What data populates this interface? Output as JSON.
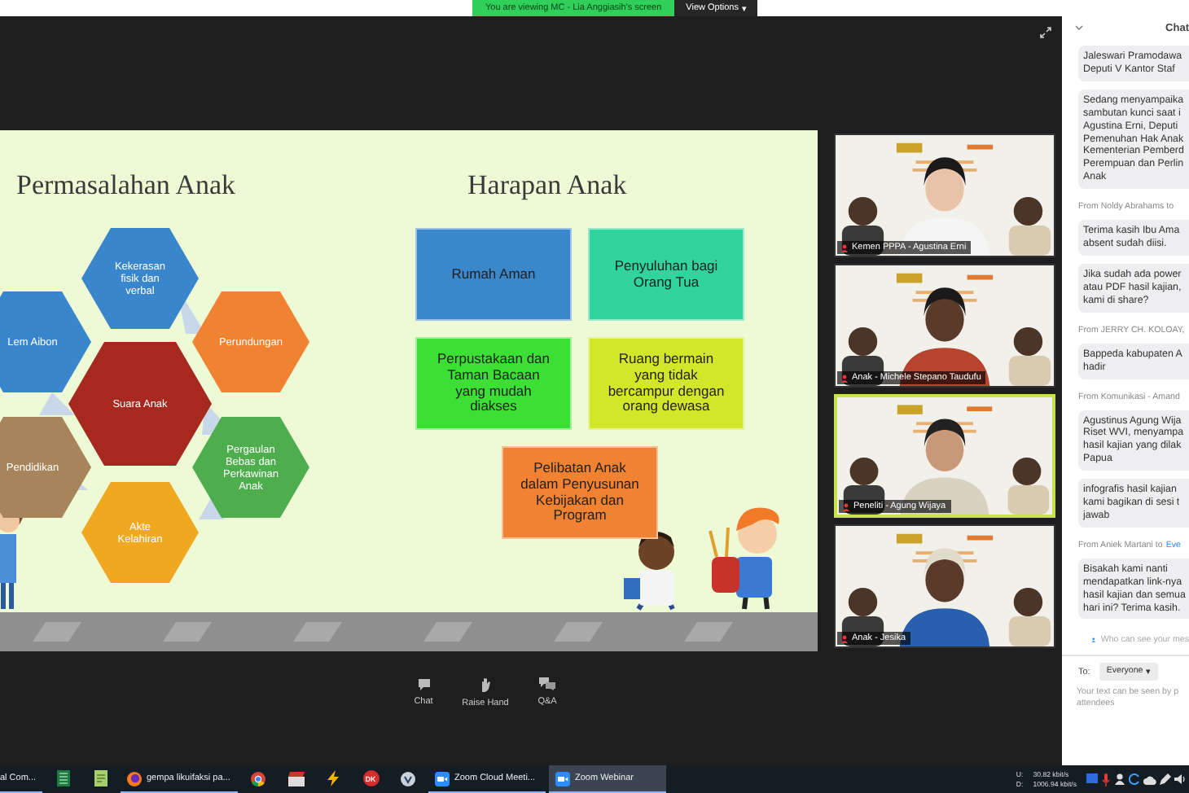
{
  "viewing_banner": {
    "text": "You are viewing MC - Lia Anggiasih's screen",
    "options_label": "View Options",
    "options_caret": "▾"
  },
  "slide": {
    "left_title": "Permasalahan Anak",
    "hexagons": [
      {
        "label": "Kekerasan\nfisik dan\nverbal",
        "color": "#3a86cc"
      },
      {
        "label": "Lem Aibon",
        "color": "#3a86cc"
      },
      {
        "label": "Perundungan",
        "color": "#f08232"
      },
      {
        "label": "Suara Anak",
        "color": "#a6281f"
      },
      {
        "label": "Pendidikan",
        "color": "#a8845a"
      },
      {
        "label": "Pergaulan\nBebas dan\nPerkawinan\nAnak",
        "color": "#4eae4e"
      },
      {
        "label": "Akte\nKelahiran",
        "color": "#f0a820"
      }
    ],
    "right_title": "Harapan Anak",
    "boxes": [
      {
        "label": "Rumah Aman",
        "color": "#3a88cc"
      },
      {
        "label": "Penyuluhan bagi\nOrang Tua",
        "color": "#30d49c"
      },
      {
        "label": "Perpustakaan dan\nTaman Bacaan\nyang mudah\ndiakses",
        "color": "#3ce034"
      },
      {
        "label": "Ruang bermain\nyang tidak\nbercampur dengan\norang dewasa",
        "color": "#d2e62a"
      },
      {
        "label": "Pelibatan Anak\ndalam Penyusunan\nKebijakan dan\nProgram",
        "color": "#f08232"
      }
    ]
  },
  "videos": [
    {
      "name": "Kemen PPPA - Agustina Erni",
      "active": false
    },
    {
      "name": "Anak - Michele Stepano Taudufu",
      "active": false
    },
    {
      "name": "Peneliti - Agung Wijaya",
      "active": true
    },
    {
      "name": "Anak - Jesika",
      "active": false
    }
  ],
  "toolbar": [
    {
      "kind": "chat",
      "label": "Chat"
    },
    {
      "kind": "hand",
      "label": "Raise Hand"
    },
    {
      "kind": "qa",
      "label": "Q&A"
    }
  ],
  "chat": {
    "title": "Chat",
    "entries": [
      {
        "kind": "message",
        "text": "Jaleswari Pramodawa\nDeputi V Kantor Staf"
      },
      {
        "kind": "message",
        "text": "Sedang menyampaika\nsambutan kunci saat i\nAgustina Erni, Deputi\nPemenuhan Hak Anak\nKementerian Pemberd\nPerempuan dan Perlin\nAnak"
      },
      {
        "kind": "sender",
        "text": "From Noldy Abrahams to"
      },
      {
        "kind": "message",
        "text": "Terima kasih Ibu Ama\nabsent sudah diisi."
      },
      {
        "kind": "message",
        "text": "Jika sudah ada power\natau PDF hasil kajian,\nkami di share?"
      },
      {
        "kind": "sender",
        "text": "From JERRY CH. KOLOAY,"
      },
      {
        "kind": "message",
        "text": "Bappeda kabupaten A\nhadir"
      },
      {
        "kind": "sender",
        "text": "From Komunikasi - Amand"
      },
      {
        "kind": "message",
        "text": "Agustinus Agung Wija\nRiset WVI, menyampa\nhasil kajian yang dilak\nPapua"
      },
      {
        "kind": "message",
        "text": "infografis hasil kajian\nkami bagikan di sesi t\njawab"
      },
      {
        "kind": "sender",
        "text": "From Aniek Martani to",
        "to": "Eve"
      },
      {
        "kind": "message",
        "text": "Bisakah kami nanti\nmendapatkan link-nya\nhasil kajian dan semua\nhari ini? Terima kasih."
      }
    ],
    "visibility_note": "Who can see your mes",
    "to_label": "To:",
    "recipient": "Everyone",
    "recipient_caret": "▾",
    "placeholder": "Your text can be seen by p\nattendees"
  },
  "taskbar": {
    "items": [
      {
        "kind": "none",
        "label": "al Com...",
        "running": true,
        "selected": false
      },
      {
        "kind": "sheet",
        "running": false,
        "selected": false
      },
      {
        "kind": "note",
        "running": false,
        "selected": false
      },
      {
        "kind": "firefox",
        "label": "gempa likuifaksi pa...",
        "running": true,
        "selected": false
      },
      {
        "kind": "chrome",
        "running": false,
        "selected": false
      },
      {
        "kind": "clapper",
        "running": false,
        "selected": false
      },
      {
        "kind": "bolt",
        "running": false,
        "selected": false
      },
      {
        "kind": "badge",
        "label": "DK",
        "running": false,
        "selected": false
      },
      {
        "kind": "check",
        "running": false,
        "selected": false
      },
      {
        "kind": "zoom",
        "label": "Zoom Cloud Meeti...",
        "running": true,
        "selected": false
      },
      {
        "kind": "zoom",
        "label": "Zoom Webinar",
        "running": true,
        "selected": true
      }
    ],
    "net": {
      "up_label": "U:",
      "up": "30.82 kbit/s",
      "down_label": "D:",
      "down": "1006.94 kbit/s"
    }
  }
}
